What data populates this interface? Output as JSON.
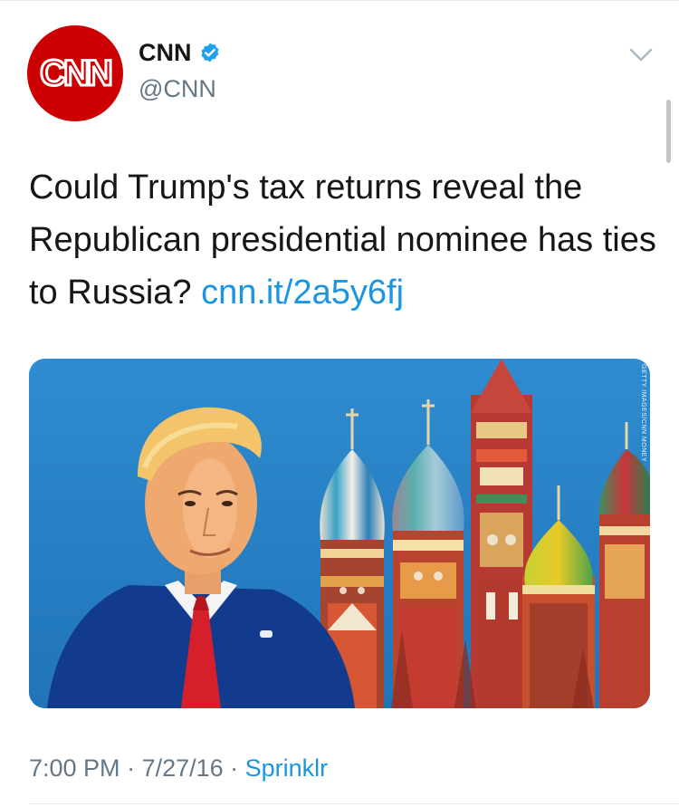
{
  "tweet": {
    "avatar": {
      "logo_text": "CNN",
      "bg_color": "#cc0000"
    },
    "author": {
      "name": "CNN",
      "handle": "@CNN",
      "verified": true,
      "verified_icon": "verified-badge-icon"
    },
    "menu_icon": "chevron-down-icon",
    "text": "Could Trump's tax returns reveal the Republican presidential nominee has ties to Russia?",
    "link": "cnn.it/2a5y6fj",
    "media": {
      "credit": "GETTY IMAGES/CNN MONEY"
    },
    "time": "7:00 PM",
    "date": "7/27/16",
    "source": "Sprinklr",
    "separator": " · "
  },
  "colors": {
    "link": "#1b95e0",
    "secondary_text": "#657786",
    "verified": "#1da1f2"
  }
}
